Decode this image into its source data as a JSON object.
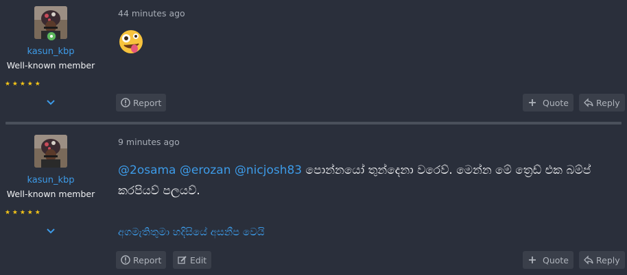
{
  "posts": [
    {
      "username": "kasun_kbp",
      "user_title": "Well-known member",
      "stars": "★ ★ ★ ★ ★",
      "time": "44 minutes ago",
      "content_emoji": "zany-face",
      "actions": {
        "report": "Report",
        "quote": "Quote",
        "reply": "Reply"
      }
    },
    {
      "username": "kasun_kbp",
      "user_title": "Well-known member",
      "stars": "★ ★ ★ ★ ★",
      "time": "9 minutes ago",
      "mentions": [
        "@2osama",
        "@erozan",
        "@nicjosh83"
      ],
      "message_rest": " පොන්නයෝ තුන්දෙනා වරෙව්. මෙන්න මේ ත්‍රෙඩ් එක බම්ප් කරපියව් පලයව්.",
      "signature": "අගමැතිතුමා හදිසියේ අසනීප වෙයි",
      "actions": {
        "report": "Report",
        "edit": "Edit",
        "quote": "Quote",
        "reply": "Reply"
      }
    }
  ],
  "colors": {
    "background": "#2a2f3b",
    "link": "#3d9be8",
    "button_bg": "#3a3f4a",
    "star": "#f5c518",
    "online": "#5cb85c"
  }
}
